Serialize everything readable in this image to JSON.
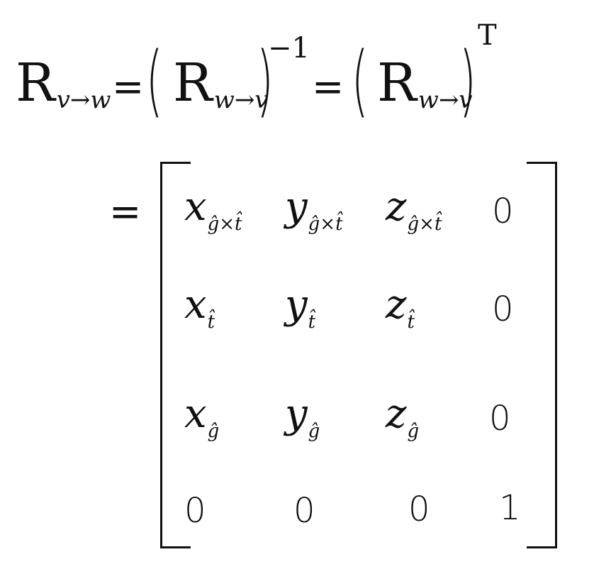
{
  "equation": {
    "line1": {
      "lhs": {
        "symbol": "R",
        "subscript": "v→w"
      },
      "equals_1": "=",
      "term1": {
        "symbol": "R",
        "subscript": "w→v",
        "superscript": "−1"
      },
      "equals_2": "=",
      "term2": {
        "symbol": "R",
        "subscript": "w→v",
        "superscript": "T"
      }
    },
    "line2": {
      "equals": "="
    },
    "matrix": {
      "rows": [
        [
          {
            "base": "x",
            "sub": "ĝ×t̂"
          },
          {
            "base": "y",
            "sub": "ĝ×t̂"
          },
          {
            "base": "z",
            "sub": "ĝ×t̂"
          },
          {
            "base": "0",
            "sub": ""
          }
        ],
        [
          {
            "base": "x",
            "sub": "t̂"
          },
          {
            "base": "y",
            "sub": "t̂"
          },
          {
            "base": "z",
            "sub": "t̂"
          },
          {
            "base": "0",
            "sub": ""
          }
        ],
        [
          {
            "base": "x",
            "sub": "ĝ"
          },
          {
            "base": "y",
            "sub": "ĝ"
          },
          {
            "base": "z",
            "sub": "ĝ"
          },
          {
            "base": "0",
            "sub": ""
          }
        ],
        [
          {
            "base": "0",
            "sub": ""
          },
          {
            "base": "0",
            "sub": ""
          },
          {
            "base": "0",
            "sub": ""
          },
          {
            "base": "1",
            "sub": ""
          }
        ]
      ]
    }
  }
}
